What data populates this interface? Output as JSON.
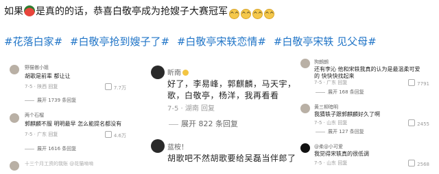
{
  "headline": {
    "part1": "如果",
    "part2": "是真的的话，恭喜白敬亭成为抢嫂子大赛冠军"
  },
  "tags": [
    "#花落白家#",
    "#白敬亭抢到嫂子了#",
    "#白敬亭宋轶恋情#",
    "#白敬亭宋轶 见父母#"
  ],
  "panel1": {
    "comments": [
      {
        "user": "野猫傲小姐",
        "text": "胡歌是前辈 都让让",
        "meta": "7-5 · 陕西  回复",
        "likes": "7.7万",
        "expand": "展开 1739 条回复"
      },
      {
        "user": "两个石榴",
        "text": "郭麒麟不服 明明最早 怎么能提名都没有",
        "meta": "7-5 · 广东  回复",
        "likes": "4.6万",
        "expand": "展开 1616 条回复"
      },
      {
        "user": "十三个月工资的我账 @花猫啃啃",
        "text": "",
        "meta": "",
        "likes": "",
        "expand": ""
      }
    ]
  },
  "panel2": {
    "comments": [
      {
        "user": "昕南",
        "lines": [
          "好了，李易峰，郭麒麟，马天宇，",
          "歌，白敬亭，杨洋，我再看看"
        ],
        "meta": "7-5 · 湖南    回复",
        "expand": "展开 822 条回复"
      },
      {
        "user": "蓝桉！",
        "lines": [
          "胡歌吧不然胡歌要给吴磊当伴郎了"
        ],
        "meta": "",
        "expand": ""
      }
    ]
  },
  "panel3": {
    "comments": [
      {
        "user": "狗朗朗",
        "lines": [
          "还有李沁 他和宋轶我真的认为是最温柔可爱",
          "的 快快快找起来"
        ],
        "meta": "7-5 · 广东  回复",
        "likes": "7791",
        "expand": "展开 168 条回复"
      },
      {
        "user": "黄三柳暗明",
        "lines": [
          "我猜轶子跟郭麒麟好久了啊"
        ],
        "meta": "7-5 · 山东  回复",
        "likes": "2455",
        "expand": "展开 127 条回复"
      },
      {
        "user": "@柔@小可爱",
        "lines": [
          "我觉得宋轶真的很低调"
        ],
        "meta": "7-5 · 山东  回复",
        "likes": "2568",
        "expand": ""
      }
    ]
  }
}
